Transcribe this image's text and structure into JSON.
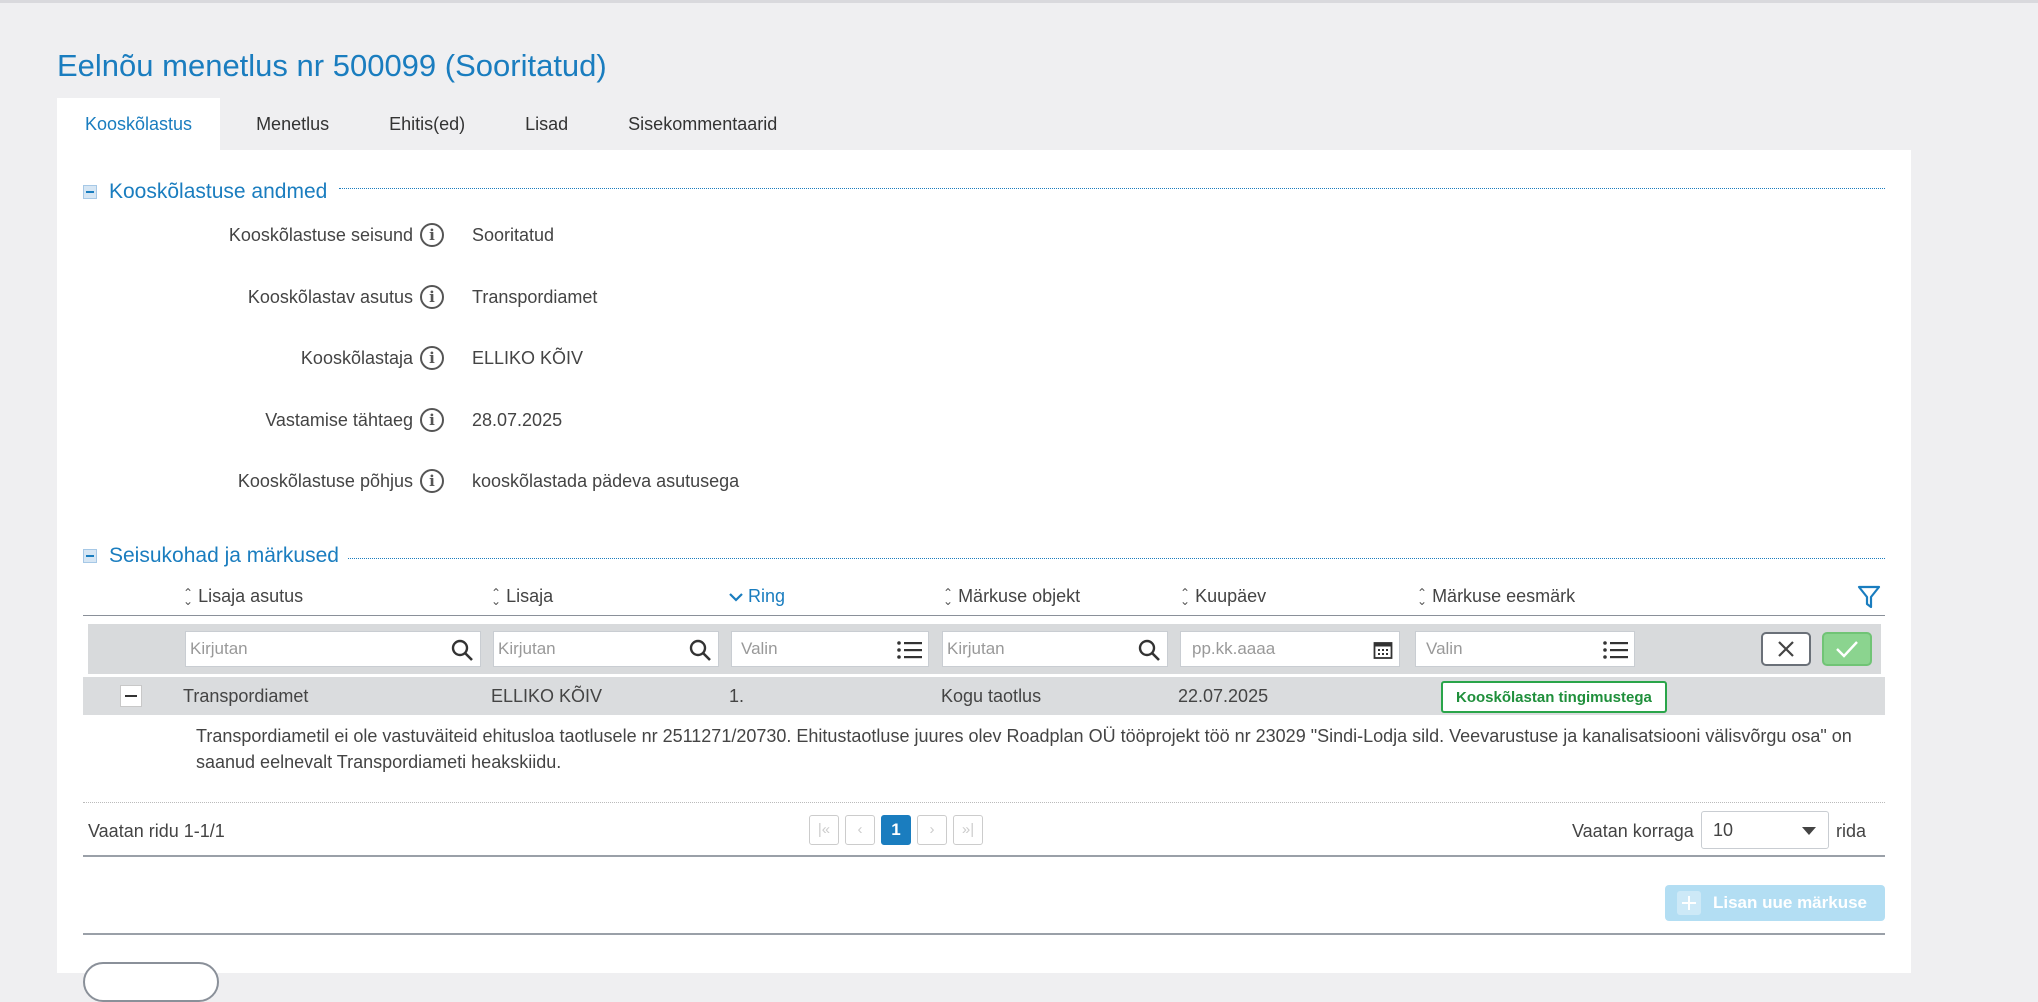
{
  "page": {
    "title": "Eelnõu menetlus nr 500099 (Sooritatud)"
  },
  "tabs": [
    {
      "label": "Kooskõlastus",
      "active": true
    },
    {
      "label": "Menetlus"
    },
    {
      "label": "Ehitis(ed)"
    },
    {
      "label": "Lisad"
    },
    {
      "label": "Sisekommentaarid"
    }
  ],
  "approval_section": {
    "title": "Kooskõlastuse andmed",
    "fields": [
      {
        "label": "Kooskõlastuse seisund",
        "value": "Sooritatud"
      },
      {
        "label": "Kooskõlastav asutus",
        "value": "Transpordiamet"
      },
      {
        "label": "Kooskõlastaja",
        "value": "ELLIKO KÕIV"
      },
      {
        "label": "Vastamise tähtaeg",
        "value": "28.07.2025"
      },
      {
        "label": "Kooskõlastuse põhjus",
        "value": "kooskõlastada pädeva asutusega"
      }
    ]
  },
  "comments_section": {
    "title": "Seisukohad ja märkused",
    "columns": [
      {
        "label": "Lisaja asutus"
      },
      {
        "label": "Lisaja"
      },
      {
        "label": "Ring",
        "sorted": "desc"
      },
      {
        "label": "Märkuse objekt"
      },
      {
        "label": "Kuupäev"
      },
      {
        "label": "Märkuse eesmärk"
      }
    ],
    "filters": {
      "institution_placeholder": "Kirjutan",
      "author_placeholder": "Kirjutan",
      "round_placeholder": "Valin",
      "object_placeholder": "Kirjutan",
      "date_placeholder": "pp.kk.aaaa",
      "purpose_placeholder": "Valin"
    },
    "rows": [
      {
        "institution": "Transpordiamet",
        "author": "ELLIKO KÕIV",
        "round": "1.",
        "object": "Kogu taotlus",
        "date": "22.07.2025",
        "purpose": "Kooskõlastan tingimustega",
        "text": "Transpordiametil ei ole vastuväiteid ehitusloa taotlusele nr 2511271/20730. Ehitustaotluse juures olev Roadplan OÜ tööprojekt töö nr 23029 \"Sindi-Lodja sild. Veevarustuse ja kanalisatsiooni välisvõrgu osa\" on saanud eelnevalt Transpordiameti heakskiidu."
      }
    ],
    "pagination": {
      "info": "Vaatan ridu 1-1/1",
      "first": "|«",
      "prev": "‹",
      "current_page": "1",
      "next": "›",
      "last": "»|",
      "per_page_label": "Vaatan korraga",
      "per_page_value": "10",
      "rows_suffix": "rida"
    },
    "add_button_label": "Lisan uue märkuse"
  },
  "colors": {
    "accent": "#1a7dbf",
    "badge_green": "#2aa54a",
    "background": "#efeff1"
  }
}
